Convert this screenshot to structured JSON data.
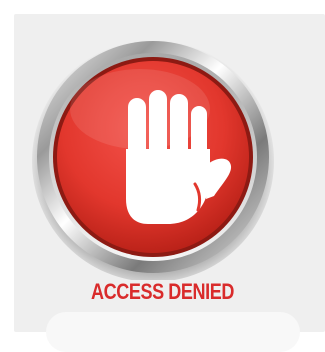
{
  "message": {
    "caption": "ACCESS DENIED"
  },
  "icon": {
    "name": "stop-hand-icon",
    "symbol": "open-palm"
  },
  "colors": {
    "red": "#e53b2c",
    "redDark": "#b81f16",
    "caption": "#d92b2b",
    "panel": "#efefef"
  }
}
